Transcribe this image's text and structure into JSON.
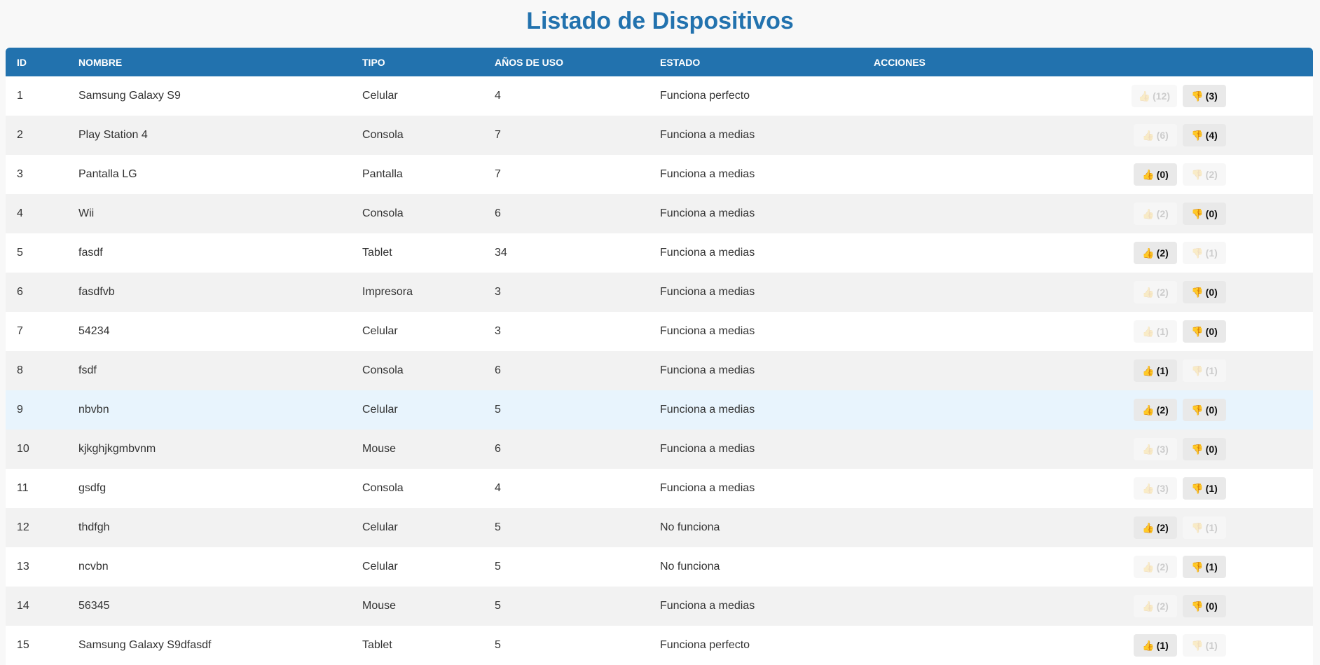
{
  "page_title": "Listado de Dispositivos",
  "columns": [
    "ID",
    "NOMBRE",
    "TIPO",
    "AÑOS DE USO",
    "ESTADO",
    "ACCIONES"
  ],
  "icons": {
    "like": "thumbs-up-icon",
    "dislike": "thumbs-down-icon"
  },
  "colors": {
    "header": "#2272ae",
    "title": "#2272ae",
    "highlight_row": "#e8f4fd"
  },
  "rows": [
    {
      "id": "1",
      "nombre": "Samsung Galaxy S9",
      "tipo": "Celular",
      "anios": "4",
      "estado": "Funciona perfecto",
      "like": "(12)",
      "dislike": "(3)",
      "voted": "dislike"
    },
    {
      "id": "2",
      "nombre": "Play Station 4",
      "tipo": "Consola",
      "anios": "7",
      "estado": "Funciona a medias",
      "like": "(6)",
      "dislike": "(4)",
      "voted": "dislike"
    },
    {
      "id": "3",
      "nombre": "Pantalla LG",
      "tipo": "Pantalla",
      "anios": "7",
      "estado": "Funciona a medias",
      "like": "(0)",
      "dislike": "(2)",
      "voted": "like"
    },
    {
      "id": "4",
      "nombre": "Wii",
      "tipo": "Consola",
      "anios": "6",
      "estado": "Funciona a medias",
      "like": "(2)",
      "dislike": "(0)",
      "voted": "dislike"
    },
    {
      "id": "5",
      "nombre": "fasdf",
      "tipo": "Tablet",
      "anios": "34",
      "estado": "Funciona a medias",
      "like": "(2)",
      "dislike": "(1)",
      "voted": "like"
    },
    {
      "id": "6",
      "nombre": "fasdfvb",
      "tipo": "Impresora",
      "anios": "3",
      "estado": "Funciona a medias",
      "like": "(2)",
      "dislike": "(0)",
      "voted": "dislike"
    },
    {
      "id": "7",
      "nombre": "54234",
      "tipo": "Celular",
      "anios": "3",
      "estado": "Funciona a medias",
      "like": "(1)",
      "dislike": "(0)",
      "voted": "dislike"
    },
    {
      "id": "8",
      "nombre": "fsdf",
      "tipo": "Consola",
      "anios": "6",
      "estado": "Funciona a medias",
      "like": "(1)",
      "dislike": "(1)",
      "voted": "like"
    },
    {
      "id": "9",
      "nombre": "nbvbn",
      "tipo": "Celular",
      "anios": "5",
      "estado": "Funciona a medias",
      "like": "(2)",
      "dislike": "(0)",
      "voted": "both"
    },
    {
      "id": "10",
      "nombre": "kjkghjkgmbvnm",
      "tipo": "Mouse",
      "anios": "6",
      "estado": "Funciona a medias",
      "like": "(3)",
      "dislike": "(0)",
      "voted": "dislike"
    },
    {
      "id": "11",
      "nombre": "gsdfg",
      "tipo": "Consola",
      "anios": "4",
      "estado": "Funciona a medias",
      "like": "(3)",
      "dislike": "(1)",
      "voted": "dislike"
    },
    {
      "id": "12",
      "nombre": "thdfgh",
      "tipo": "Celular",
      "anios": "5",
      "estado": "No funciona",
      "like": "(2)",
      "dislike": "(1)",
      "voted": "like"
    },
    {
      "id": "13",
      "nombre": "ncvbn",
      "tipo": "Celular",
      "anios": "5",
      "estado": "No funciona",
      "like": "(2)",
      "dislike": "(1)",
      "voted": "dislike"
    },
    {
      "id": "14",
      "nombre": "56345",
      "tipo": "Mouse",
      "anios": "5",
      "estado": "Funciona a medias",
      "like": "(2)",
      "dislike": "(0)",
      "voted": "dislike"
    },
    {
      "id": "15",
      "nombre": "Samsung Galaxy S9dfasdf",
      "tipo": "Tablet",
      "anios": "5",
      "estado": "Funciona perfecto",
      "like": "(1)",
      "dislike": "(1)",
      "voted": "like"
    }
  ]
}
